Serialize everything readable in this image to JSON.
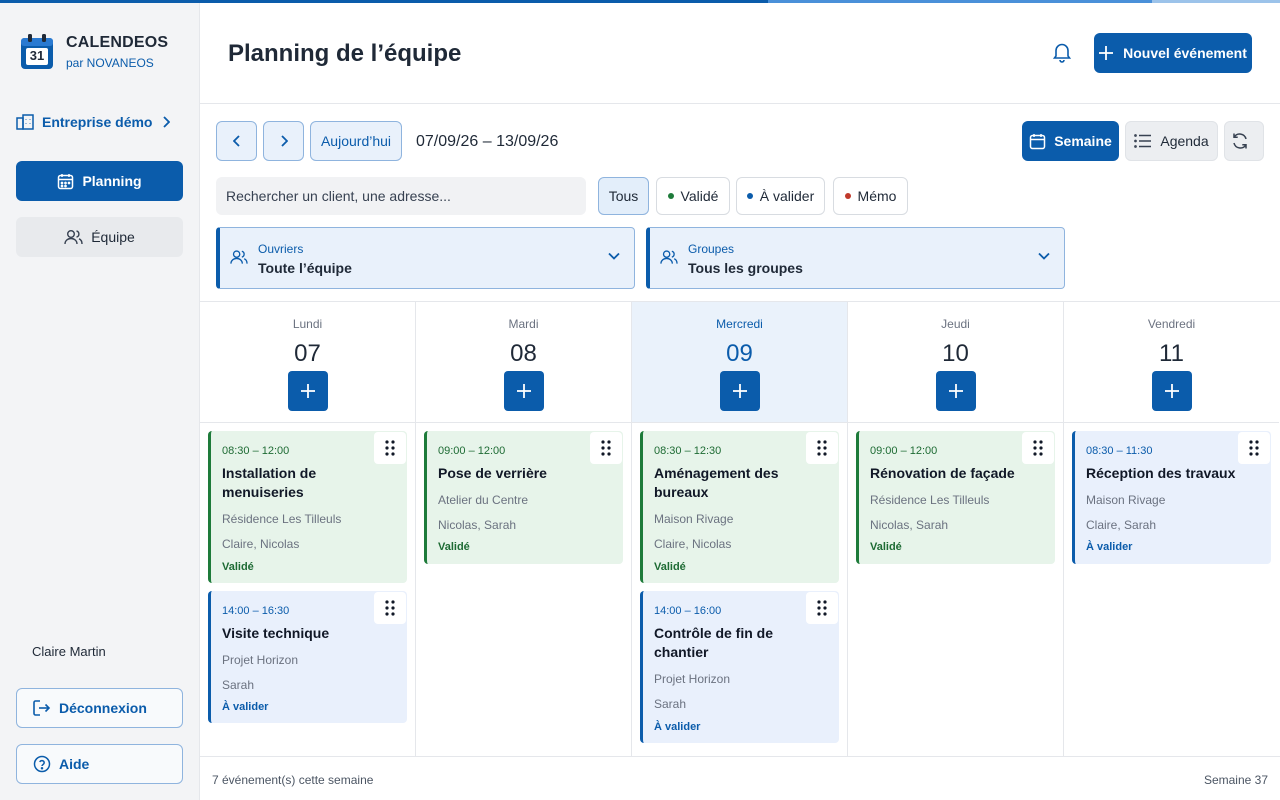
{
  "brand": {
    "name": "CALENDEOS",
    "subtitle": "par NOVANEOS",
    "logo_day": "31"
  },
  "sidebar": {
    "company": "Entreprise démo",
    "items": [
      {
        "label": "Planning",
        "icon": "calendar-icon",
        "active": true
      },
      {
        "label": "Équipe",
        "icon": "users-icon",
        "active": false
      }
    ],
    "user_name": "Claire Martin",
    "logout_label": "Déconnexion",
    "help_label": "Aide"
  },
  "header": {
    "title": "Planning de l’équipe",
    "new_event_label": "Nouvel événement"
  },
  "toolbar": {
    "today_label": "Aujourd’hui",
    "date_range": "07/09/26 – 13/09/26",
    "views": {
      "week": "Semaine",
      "agenda": "Agenda"
    }
  },
  "search": {
    "placeholder": "Rechercher un client, une adresse..."
  },
  "filters": [
    {
      "label": "Tous",
      "selected": true
    },
    {
      "label": "Validé",
      "color": "#1e7b3a"
    },
    {
      "label": "À valider",
      "color": "#0b5cab"
    },
    {
      "label": "Mémo",
      "color": "#c0392b"
    }
  ],
  "selects": {
    "workers": {
      "label": "Ouvriers",
      "value": "Toute l’équipe"
    },
    "groups": {
      "label": "Groupes",
      "value": "Tous les groupes"
    }
  },
  "days": [
    {
      "name": "Lundi",
      "num": "07",
      "today": false,
      "events": [
        {
          "time": "08:30 – 12:00",
          "title": "Installation de menuiseries",
          "location": "Résidence Les Tilleuls",
          "people": "Claire, Nicolas",
          "status": "Validé",
          "kind": "green"
        },
        {
          "time": "14:00 – 16:30",
          "title": "Visite technique",
          "location": "Projet Horizon",
          "people": "Sarah",
          "status": "À valider",
          "kind": "blue"
        }
      ]
    },
    {
      "name": "Mardi",
      "num": "08",
      "today": false,
      "events": [
        {
          "time": "09:00 – 12:00",
          "title": "Pose de verrière",
          "location": "Atelier du Centre",
          "people": "Nicolas, Sarah",
          "status": "Validé",
          "kind": "green"
        }
      ]
    },
    {
      "name": "Mercredi",
      "num": "09",
      "today": true,
      "events": [
        {
          "time": "08:30 – 12:30",
          "title": "Aménagement des bureaux",
          "location": "Maison Rivage",
          "people": "Claire, Nicolas",
          "status": "Validé",
          "kind": "green"
        },
        {
          "time": "14:00 – 16:00",
          "title": "Contrôle de fin de chantier",
          "location": "Projet Horizon",
          "people": "Sarah",
          "status": "À valider",
          "kind": "blue"
        }
      ]
    },
    {
      "name": "Jeudi",
      "num": "10",
      "today": false,
      "events": [
        {
          "time": "09:00 – 12:00",
          "title": "Rénovation de façade",
          "location": "Résidence Les Tilleuls",
          "people": "Nicolas, Sarah",
          "status": "Validé",
          "kind": "green"
        }
      ]
    },
    {
      "name": "Vendredi",
      "num": "11",
      "today": false,
      "events": [
        {
          "time": "08:30 – 11:30",
          "title": "Réception des travaux",
          "location": "Maison Rivage",
          "people": "Claire, Sarah",
          "status": "À valider",
          "kind": "blue"
        }
      ]
    }
  ],
  "footer": {
    "event_count": "7 événement(s) cette semaine",
    "week_label": "Semaine 37"
  }
}
